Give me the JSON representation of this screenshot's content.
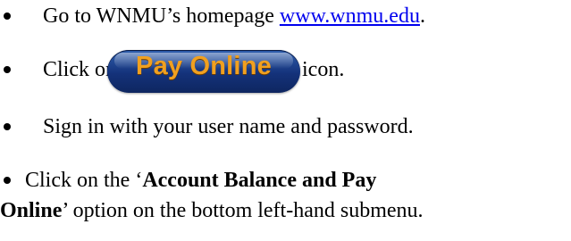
{
  "items": [
    {
      "before": "Go to WNMU’s homepage ",
      "link": "www.wnmu.edu",
      "after": "."
    },
    {
      "before": "Click on the ",
      "button": "Pay Online",
      "after": " icon."
    },
    {
      "text": "Sign in with your user name and password."
    },
    {
      "before": "Click on the ‘",
      "bold1": "Account Balance and Pay",
      "bold2": "Online",
      "after": "’ option on the bottom left-hand submenu."
    }
  ],
  "colors": {
    "link": "#0000ee",
    "button_bg": "#14327a",
    "button_text": "#f0a020"
  }
}
